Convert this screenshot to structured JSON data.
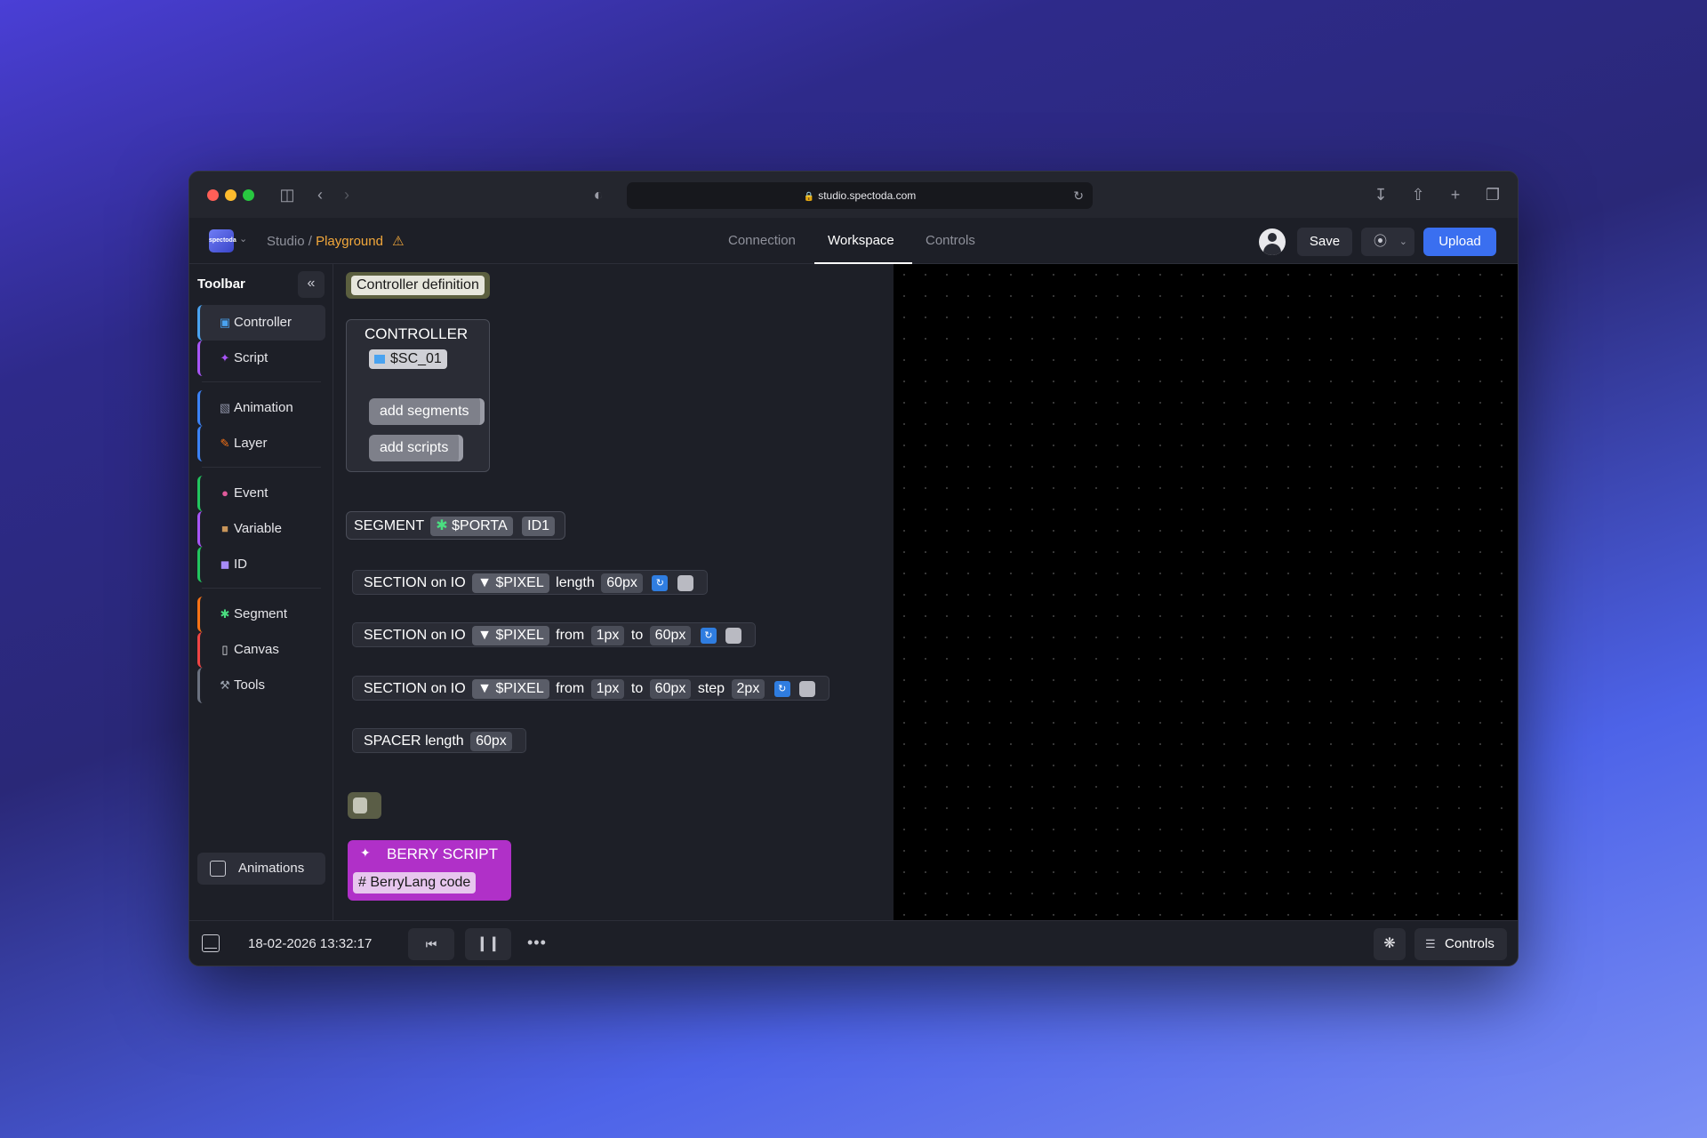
{
  "browser": {
    "url": "studio.spectoda.com",
    "traffic_colors": [
      "#ff5f57",
      "#febc2e",
      "#28c840"
    ]
  },
  "header": {
    "logo_text": "spectoda",
    "breadcrumb_root": "Studio",
    "breadcrumb_sep": "/",
    "breadcrumb_current": "Playground",
    "tabs": [
      "Connection",
      "Workspace",
      "Controls"
    ],
    "active_tab": "Workspace",
    "save_label": "Save",
    "upload_label": "Upload",
    "accent": "#3a6ff0",
    "warning_color": "#f3a83b"
  },
  "sidebar": {
    "title": "Toolbar",
    "items": [
      {
        "label": "Controller",
        "icon": "monitor-icon",
        "color": "#4aa3f0"
      },
      {
        "label": "Script",
        "icon": "wand-icon",
        "color": "#a855f7"
      },
      {
        "label": "Animation",
        "icon": "clapper-icon",
        "color": "#3b82f6"
      },
      {
        "label": "Layer",
        "icon": "pencil-icon",
        "color": "#3b82f6"
      },
      {
        "label": "Event",
        "icon": "joystick-icon",
        "color": "#22c55e"
      },
      {
        "label": "Variable",
        "icon": "box-icon",
        "color": "#a855f7"
      },
      {
        "label": "ID",
        "icon": "id-icon",
        "color": "#22c55e"
      },
      {
        "label": "Segment",
        "icon": "puzzle-icon",
        "color": "#f97316"
      },
      {
        "label": "Canvas",
        "icon": "page-icon",
        "color": "#ef4444"
      },
      {
        "label": "Tools",
        "icon": "hammer-icon",
        "color": "#6b7280"
      }
    ],
    "bottom_button": "Animations"
  },
  "blocks": {
    "definition_hat": "Controller definition",
    "controller_title": "CONTROLLER",
    "controller_value": "$SC_01",
    "add_segments": "add segments",
    "add_scripts": "add scripts",
    "segment": {
      "label": "SEGMENT",
      "port": "$PORTA",
      "id": "ID1"
    },
    "section1": {
      "label": "SECTION on IO",
      "io": "$PIXEL",
      "kw1": "length",
      "v1": "60px"
    },
    "section2": {
      "label": "SECTION on IO",
      "io": "$PIXEL",
      "kw1": "from",
      "v1": "1px",
      "kw2": "to",
      "v2": "60px"
    },
    "section3": {
      "label": "SECTION on IO",
      "io": "$PIXEL",
      "kw1": "from",
      "v1": "1px",
      "kw2": "to",
      "v2": "60px",
      "kw3": "step",
      "v3": "2px"
    },
    "spacer": {
      "label": "SPACER",
      "kw1": "length",
      "v1": "60px"
    },
    "berry_title": "BERRY SCRIPT",
    "berry_code": "# BerryLang code"
  },
  "bottombar": {
    "timestamp": "18-02-2026 13:32:17",
    "controls_label": "Controls"
  }
}
